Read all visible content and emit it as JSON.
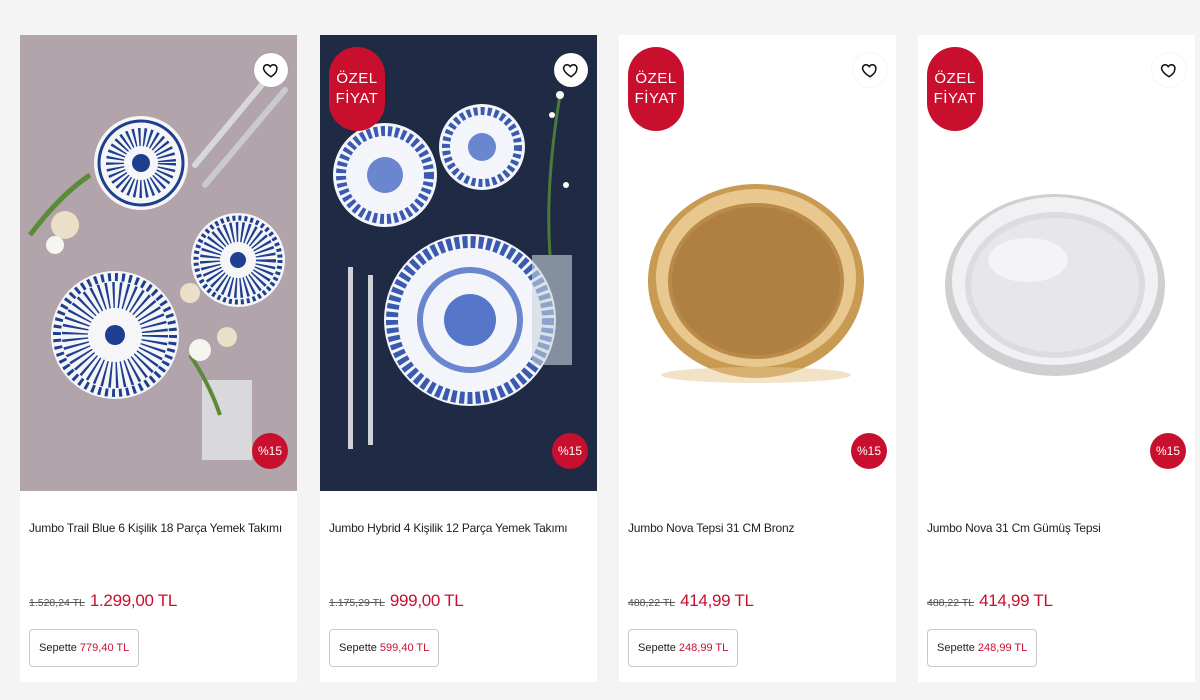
{
  "products": [
    {
      "name": "Jumbo Trail Blue 6 Kişilik 18 Parça Yemek Takımı",
      "old_price": "1.528,24 TL",
      "price": "1.299,00 TL",
      "discount": "%15",
      "basket_label": "Sepette",
      "basket_price": "779,40 TL",
      "special_badge": false
    },
    {
      "name": "Jumbo Hybrid 4 Kişilik 12 Parça Yemek Takımı",
      "old_price": "1.175,29 TL",
      "price": "999,00 TL",
      "discount": "%15",
      "basket_label": "Sepette",
      "basket_price": "599,40 TL",
      "special_badge": true,
      "special_line1": "ÖZEL",
      "special_line2": "FİYAT"
    },
    {
      "name": "Jumbo Nova Tepsi 31 CM Bronz",
      "old_price": "488,22 TL",
      "price": "414,99 TL",
      "discount": "%15",
      "basket_label": "Sepette",
      "basket_price": "248,99 TL",
      "special_badge": true,
      "special_line1": "ÖZEL",
      "special_line2": "FİYAT"
    },
    {
      "name": "Jumbo Nova 31 Cm Gümüş Tepsi",
      "old_price": "488,22 TL",
      "price": "414,99 TL",
      "discount": "%15",
      "basket_label": "Sepette",
      "basket_price": "248,99 TL",
      "special_badge": true,
      "special_line1": "ÖZEL",
      "special_line2": "FİYAT"
    }
  ],
  "colors": {
    "accent": "#c8102e",
    "background": "#f4f4f4"
  },
  "icons": {
    "favorite": "heart-outline-icon"
  }
}
